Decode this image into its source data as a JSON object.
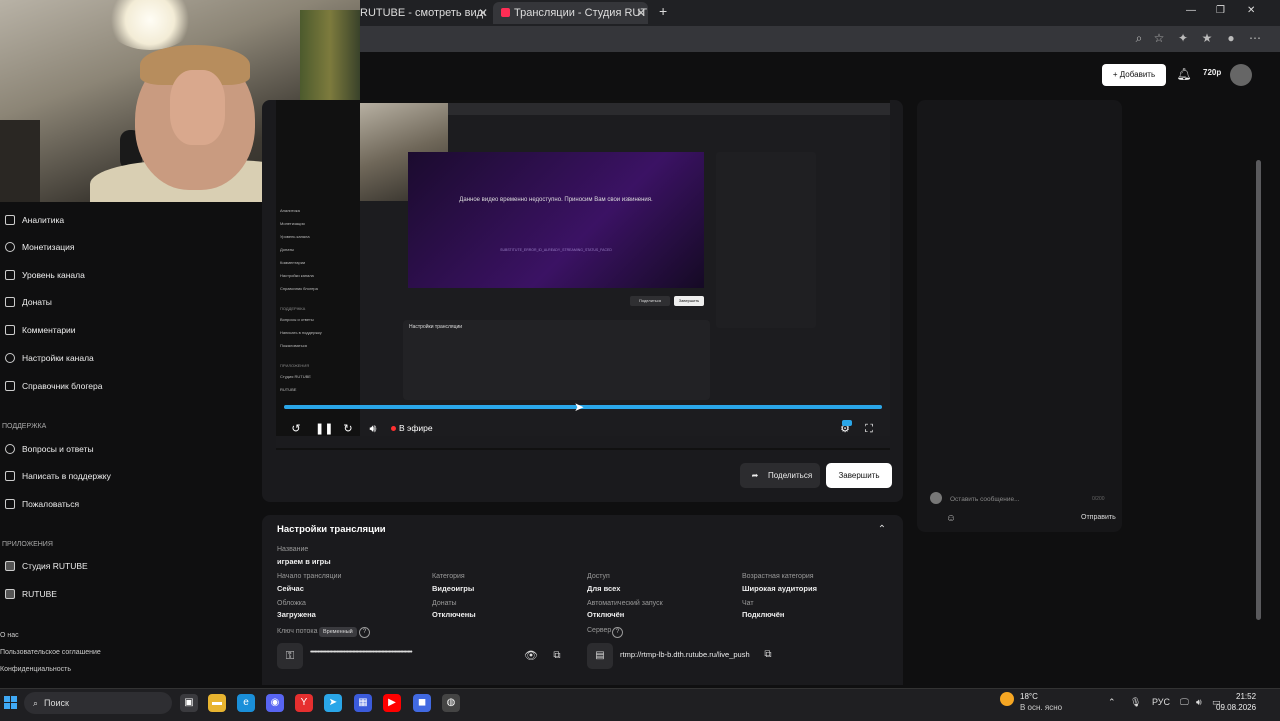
{
  "browser": {
    "tabs": [
      {
        "label": "RUTUBE - смотреть видео онлайн",
        "active": false
      },
      {
        "label": "Трансляции - Студия RUTUBE",
        "active": true
      }
    ],
    "new_tab": "+",
    "window_controls": [
      "—",
      "❐",
      "✕"
    ]
  },
  "sidebar": {
    "items": [
      {
        "label": "Аналитика",
        "icon": "chart-icon"
      },
      {
        "label": "Монетизация",
        "icon": "coin-icon"
      },
      {
        "label": "Уровень канала",
        "icon": "star-icon"
      },
      {
        "label": "Донаты",
        "icon": "gift-icon"
      },
      {
        "label": "Комментарии",
        "icon": "comment-icon"
      },
      {
        "label": "Настройки канала",
        "icon": "gear-icon"
      },
      {
        "label": "Справочник блогера",
        "icon": "book-icon"
      }
    ],
    "support_heading": "ПОДДЕРЖКА",
    "support_items": [
      {
        "label": "Вопросы и ответы",
        "icon": "question-icon"
      },
      {
        "label": "Написать в поддержку",
        "icon": "mail-icon"
      },
      {
        "label": "Пожаловаться",
        "icon": "flag-icon"
      }
    ],
    "apps_heading": "ПРИЛОЖЕНИЯ",
    "apps_items": [
      {
        "label": "Студия RUTUBE",
        "icon": "studio-icon"
      },
      {
        "label": "RUTUBE",
        "icon": "rutube-icon"
      }
    ],
    "footer": [
      "О нас",
      "Пользовательское соглашение",
      "Конфиденциальность"
    ]
  },
  "header": {
    "add_label": "+ Добавить",
    "quality": "720p"
  },
  "player": {
    "nested_message": "Данное видео временно недоступно. Приносим Вам свои извинения.",
    "nested_code": "SUBSTITUTE_ERROR_ID_ALREADY_STREAMING_STATUS_FACED",
    "nested_settings_title": "Настройки трансляции",
    "nested_share": "Поделиться",
    "nested_end": "Завершить",
    "nested_sidebar": [
      "Аналитика",
      "Монетизация",
      "Уровень канала",
      "Донаты",
      "Комментарии",
      "Настройки канала",
      "Справочник блогера",
      "ПОДДЕРЖКА",
      "Вопросы и ответы",
      "Написать в поддержку",
      "Пожаловаться",
      "ПРИЛОЖЕНИЯ",
      "Студия RUTUBE",
      "RUTUBE"
    ],
    "progress": 1.0,
    "live_label": "В эфире"
  },
  "actions": {
    "share_label": "Поделиться",
    "end_label": "Завершить"
  },
  "chat": {
    "placeholder": "Оставить сообщение...",
    "counter": "0/200",
    "send_label": "Отправить"
  },
  "settings": {
    "title": "Настройки трансляции",
    "fields": {
      "name_label": "Название",
      "name_value": "играем в игры",
      "start_label": "Начало трансляции",
      "start_value": "Сейчас",
      "category_label": "Категория",
      "category_value": "Видеоигры",
      "access_label": "Доступ",
      "access_value": "Для всех",
      "age_label": "Возрастная категория",
      "age_value": "Широкая аудитория",
      "cover_label": "Обложка",
      "cover_value": "Загружена",
      "donate_label": "Донаты",
      "donate_value": "Отключены",
      "autostart_label": "Автоматический запуск",
      "autostart_value": "Отключён",
      "chat_label": "Чат",
      "chat_value": "Подключён",
      "key_label": "Ключ потока",
      "key_badge": "Временный",
      "key_value": "••••••••••••••••••••••••••••••••••••••••••••••••••••••••••••••••••••••",
      "server_label": "Сервер",
      "server_value": "rtmp://rtmp-lb-b.dth.rutube.ru/live_push"
    }
  },
  "taskbar": {
    "search_label": "Поиск",
    "weather_temp": "18°C",
    "weather_desc": "В осн. ясно",
    "lang": "РУС",
    "time": "21:52",
    "date": "09.08.2026"
  },
  "colors": {
    "accent": "#2aa6e8",
    "live": "#ff3030"
  }
}
